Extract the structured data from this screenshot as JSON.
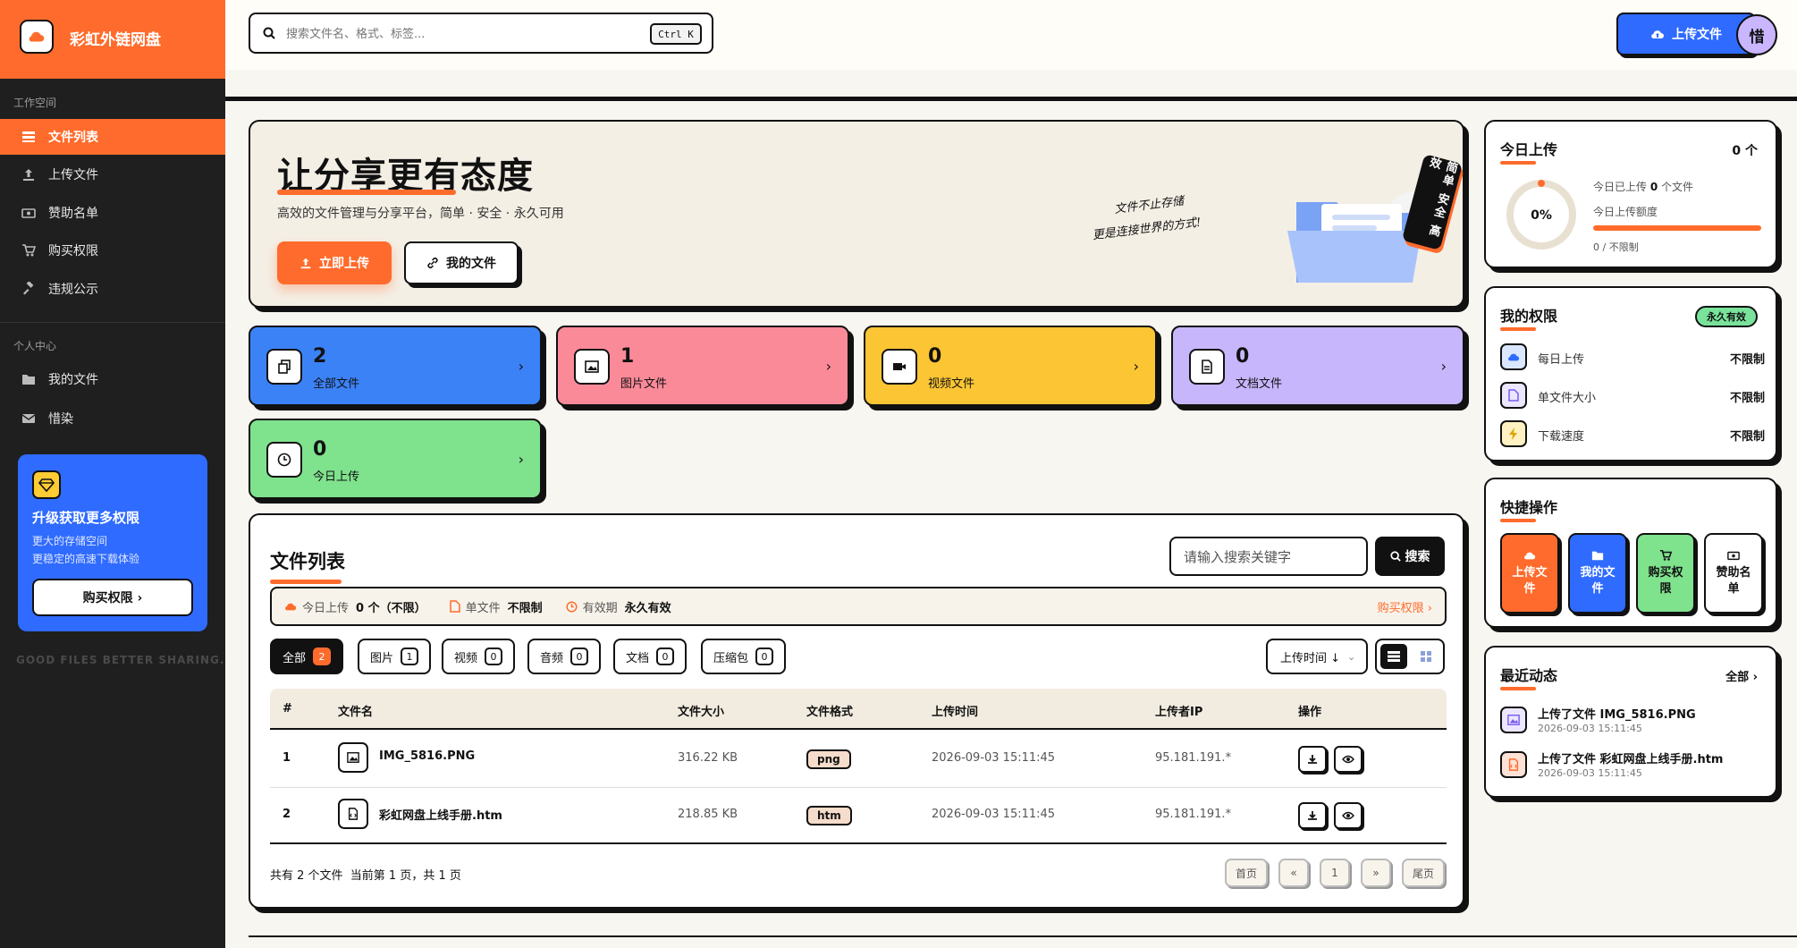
{
  "brand": {
    "name": "彩虹外链网盘"
  },
  "sidebar": {
    "workspace_label": "工作空间",
    "workspace_items": [
      {
        "label": "文件列表",
        "icon": "list-icon",
        "active": true
      },
      {
        "label": "上传文件",
        "icon": "upload-icon"
      },
      {
        "label": "赞助名单",
        "icon": "money-icon"
      },
      {
        "label": "购买权限",
        "icon": "cart-icon"
      },
      {
        "label": "违规公示",
        "icon": "gavel-icon"
      }
    ],
    "personal_label": "个人中心",
    "personal_items": [
      {
        "label": "我的文件",
        "icon": "folder-icon"
      },
      {
        "label": "惜染",
        "icon": "mail-icon"
      }
    ],
    "upgrade": {
      "title": "升级获取更多权限",
      "line1": "更大的存储空间",
      "line2": "更稳定的高速下载体验",
      "button": "购买权限 ›"
    },
    "slogan": "GOOD FILES BETTER SHARING."
  },
  "topbar": {
    "search_placeholder": "搜索文件名、格式、标签...",
    "shortcut": "Ctrl K",
    "upload_button": "上传文件",
    "avatar_initial": "惜"
  },
  "hero": {
    "title": "让分享更有态度",
    "subtitle": "高效的文件管理与分享平台，简单 · 安全 · 永久可用",
    "primary_button": "立即上传",
    "secondary_button": "我的文件",
    "quote_line1": "文件不止存储",
    "quote_line2": "更是连接世界的方式!",
    "tag": "简单 安全 高效"
  },
  "stats": [
    {
      "value": "2",
      "label": "全部文件",
      "color": "#3b82f6",
      "icon": "copy-icon"
    },
    {
      "value": "1",
      "label": "图片文件",
      "color": "#fb8a99",
      "icon": "image-icon"
    },
    {
      "value": "0",
      "label": "视频文件",
      "color": "#fcc534",
      "icon": "video-icon"
    },
    {
      "value": "0",
      "label": "文档文件",
      "color": "#c7b6fc",
      "icon": "document-icon"
    },
    {
      "value": "0",
      "label": "今日上传",
      "color": "#7fe28d",
      "icon": "clock-icon"
    }
  ],
  "file_list": {
    "title": "文件列表",
    "keyword_placeholder": "请输入搜索关键字",
    "search_button": "搜索",
    "info": {
      "today_label": "今日上传",
      "today_value": "0 个（不限）",
      "single_label": "单文件",
      "single_value": "不限制",
      "validity_label": "有效期",
      "validity_value": "永久有效",
      "buy_link": "购买权限 ›"
    },
    "filters": [
      {
        "label": "全部",
        "count": "2",
        "active": true
      },
      {
        "label": "图片",
        "count": "1"
      },
      {
        "label": "视频",
        "count": "0"
      },
      {
        "label": "音频",
        "count": "0"
      },
      {
        "label": "文档",
        "count": "0"
      },
      {
        "label": "压缩包",
        "count": "0"
      }
    ],
    "sort_label": "上传时间 ↓",
    "columns": [
      "#",
      "文件名",
      "文件大小",
      "文件格式",
      "上传时间",
      "上传者IP",
      "操作"
    ],
    "rows": [
      {
        "index": "1",
        "name": "IMG_5816.PNG",
        "size": "316.22 KB",
        "format": "png",
        "time": "2026-09-03 15:11:45",
        "ip": "95.181.191.*"
      },
      {
        "index": "2",
        "name": "彩虹网盘上线手册.htm",
        "size": "218.85 KB",
        "format": "htm",
        "time": "2026-09-03 15:11:45",
        "ip": "95.181.191.*"
      }
    ],
    "summary": "共有 2 个文件  当前第 1 页，共 1 页",
    "pager": [
      "首页",
      "«",
      "1",
      "»",
      "尾页"
    ]
  },
  "today_panel": {
    "title": "今日上传",
    "count": "0 个",
    "percent": "0%",
    "percent_value": 0,
    "line1_prefix": "今日已上传",
    "line1_value": "0",
    "line1_suffix": "个文件",
    "line2": "今日上传额度",
    "quota": "0 / 不限制"
  },
  "perm_panel": {
    "title": "我的权限",
    "badge": "永久有效",
    "items": [
      {
        "label": "每日上传",
        "value": "不限制",
        "color": "#dbe7ff",
        "icon": "cloud-icon"
      },
      {
        "label": "单文件大小",
        "value": "不限制",
        "color": "#ece6ff",
        "icon": "file-icon"
      },
      {
        "label": "下载速度",
        "value": "不限制",
        "color": "#fff1c2",
        "icon": "bolt-icon"
      }
    ]
  },
  "quick_panel": {
    "title": "快捷操作",
    "items": [
      {
        "label": "上传文件",
        "color": "#ff6b2c",
        "icon": "cloud-upload-icon",
        "dark": false
      },
      {
        "label": "我的文件",
        "color": "#2f6bff",
        "icon": "folder-icon",
        "dark": false
      },
      {
        "label": "购买权限",
        "color": "#7fe28d",
        "icon": "cart-icon",
        "dark": false
      },
      {
        "label": "赞助名单",
        "color": "#ffffff",
        "icon": "money-icon",
        "dark": true
      }
    ]
  },
  "recent_panel": {
    "title": "最近动态",
    "all_link": "全部 ›",
    "items": [
      {
        "text": "上传了文件 IMG_5816.PNG",
        "time": "2026-09-03 15:11:45",
        "color": "#ece6ff"
      },
      {
        "text": "上传了文件 彩虹网盘上线手册.htm",
        "time": "2026-09-03 15:11:45",
        "color": "#ffe2d6"
      }
    ]
  }
}
